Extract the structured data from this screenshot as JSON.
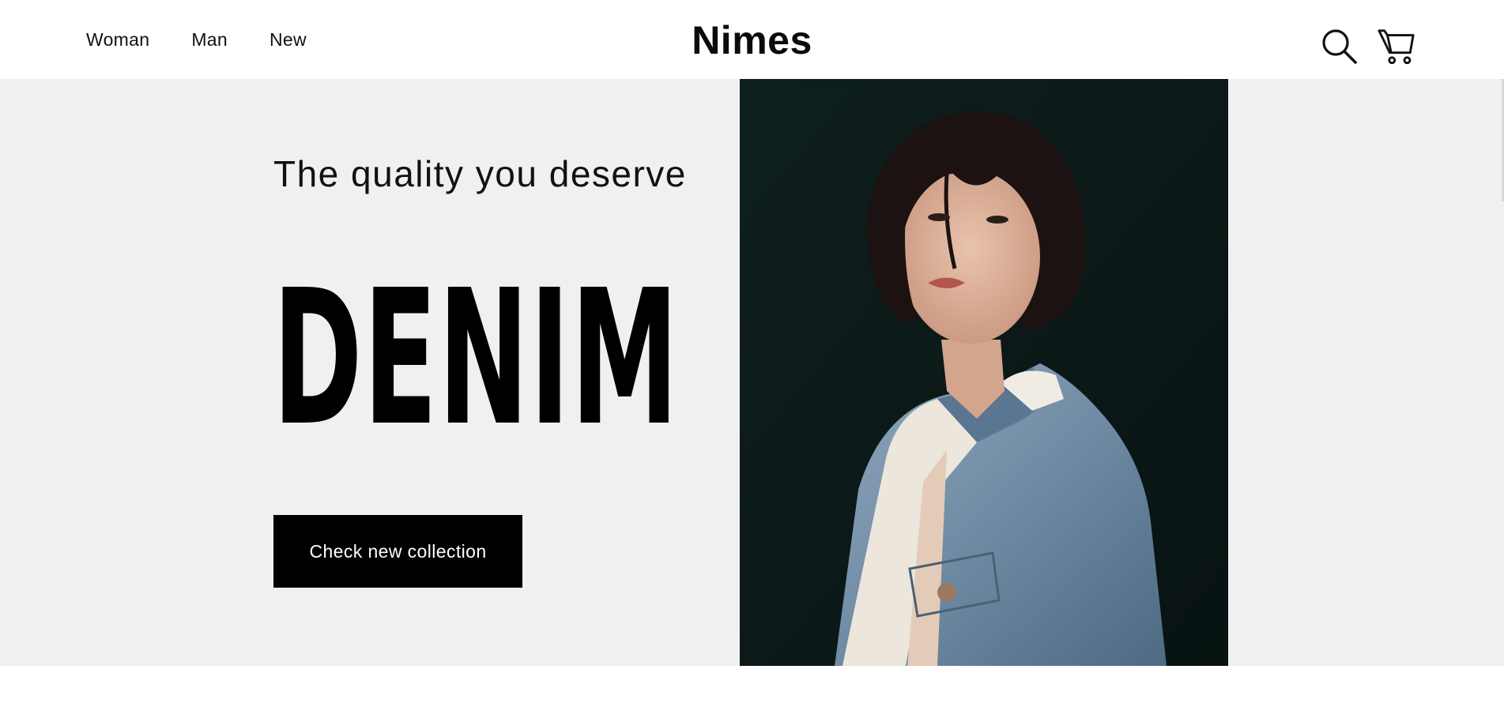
{
  "header": {
    "nav": [
      {
        "label": "Woman"
      },
      {
        "label": "Man"
      },
      {
        "label": "New"
      }
    ],
    "brand": "Nimes",
    "icons": [
      "search-icon",
      "cart-icon"
    ]
  },
  "hero": {
    "tagline": "The quality you deserve",
    "headline": "DENIM",
    "cta_label": "Check new collection"
  },
  "colors": {
    "hero_bg": "#eff0f2",
    "photo_bg": "#0c1a19",
    "text": "#000000",
    "button_bg": "#000000",
    "button_text": "#ffffff"
  }
}
